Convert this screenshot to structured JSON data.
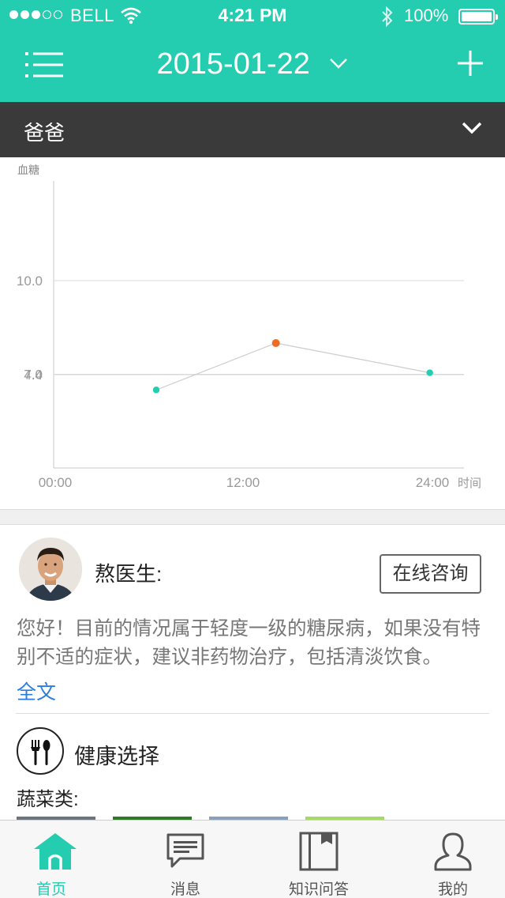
{
  "status_bar": {
    "carrier": "BELL",
    "time": "4:21 PM",
    "battery": "100%"
  },
  "nav": {
    "date": "2015-01-22"
  },
  "member": {
    "name": "爸爸"
  },
  "chart_data": {
    "type": "line",
    "ylabel": "血糖",
    "xlabel": "时间",
    "x_ticks": [
      "00:00",
      "12:00",
      "24:00"
    ],
    "y_ticks": [
      "10.0",
      "7.0",
      "4.4"
    ],
    "points": [
      {
        "x": 6,
        "y": 6.5,
        "status": "normal"
      },
      {
        "x": 13,
        "y": 8.0,
        "status": "high"
      },
      {
        "x": 22,
        "y": 7.05,
        "status": "normal"
      }
    ],
    "colors": {
      "normal": "#25cdb0",
      "high": "#f06a22",
      "line": "#cccccc",
      "grid": "#d9d9d9"
    }
  },
  "doctor": {
    "name": "熬医生:",
    "consult_label": "在线咨询",
    "message": "您好！目前的情况属于轻度一级的糖尿病，如果没有特别不适的症状，建议非药物治疗，包括清淡饮食。",
    "read_more": "全文"
  },
  "health": {
    "title": "健康选择",
    "category": "蔬菜类:"
  },
  "tabs": [
    {
      "label": "首页",
      "icon": "home-icon",
      "active": true
    },
    {
      "label": "消息",
      "icon": "message-icon",
      "active": false
    },
    {
      "label": "知识问答",
      "icon": "book-icon",
      "active": false
    },
    {
      "label": "我的",
      "icon": "user-icon",
      "active": false
    }
  ],
  "theme": {
    "accent": "#25cdb0",
    "dark_bar": "#3a3a3a",
    "link": "#2a7ee0"
  }
}
